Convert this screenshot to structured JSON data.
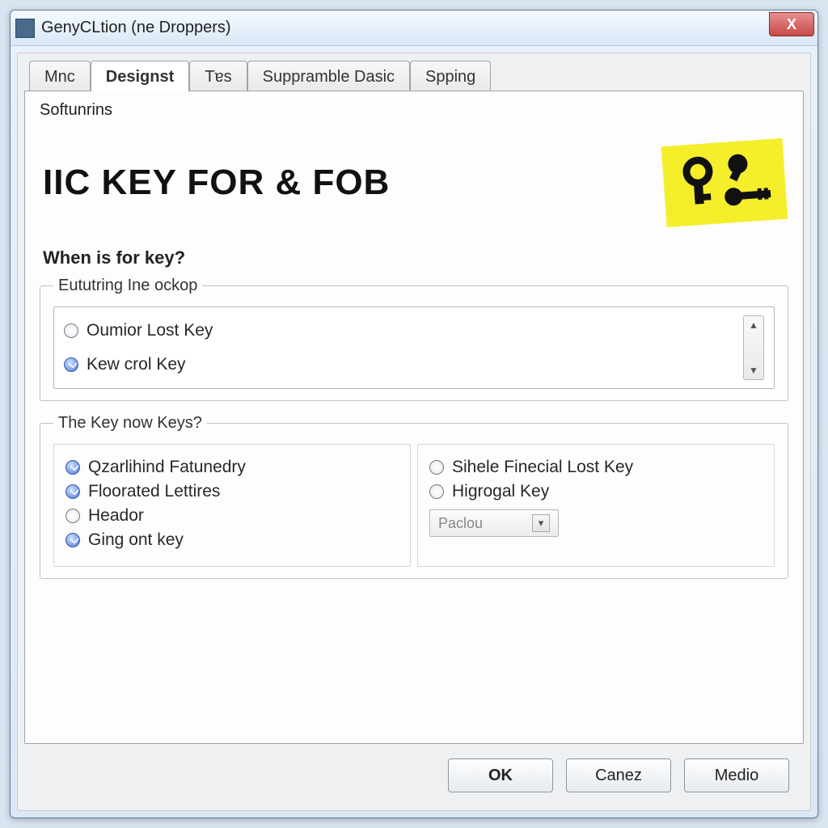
{
  "window": {
    "title": "GenyCLtion (ne Droppers)",
    "close_label": "X"
  },
  "tabs": [
    {
      "label": "Mnc",
      "active": false
    },
    {
      "label": "Designst",
      "active": true
    },
    {
      "label": "Tɐs",
      "active": false
    },
    {
      "label": "Suppramble Dasic",
      "active": false
    },
    {
      "label": "Spping",
      "active": false
    }
  ],
  "panel": {
    "group_label": "Softunrins",
    "heading": "IIC KEY FOR & FOB",
    "question1": "When is for key?",
    "list_legend": "Eututring Ine ockop",
    "list_options": [
      {
        "label": "Oumior Lost Key",
        "selected": false
      },
      {
        "label": "Kew crol Key",
        "selected": true
      }
    ],
    "question2_legend": "The Key now Keys?",
    "left_options": [
      {
        "label": "Qzarlihind Fatunedry",
        "checked": true
      },
      {
        "label": "Floorated Lettires",
        "checked": true
      },
      {
        "label": "Heador",
        "checked": false
      },
      {
        "label": "Ging ont key",
        "checked": true
      }
    ],
    "right_options": [
      {
        "label": "Sihele Finecial Lost Key",
        "checked": false
      },
      {
        "label": "Higroɡal Key",
        "checked": false
      }
    ],
    "dropdown_placeholder": "Paclou"
  },
  "buttons": {
    "ok": "OK",
    "cancel": "Canez",
    "help": "Medio"
  }
}
